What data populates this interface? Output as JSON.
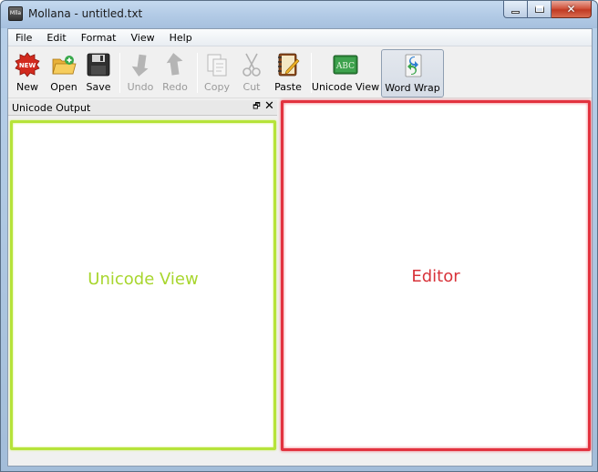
{
  "window": {
    "title": "Mollana - untitled.txt",
    "app_icon_text": "Mlla"
  },
  "menu": [
    {
      "label": "File"
    },
    {
      "label": "Edit"
    },
    {
      "label": "Format"
    },
    {
      "label": "View"
    },
    {
      "label": "Help"
    }
  ],
  "toolbar": {
    "new": {
      "label": "New",
      "icon": "new-document-icon",
      "enabled": true
    },
    "open": {
      "label": "Open",
      "icon": "open-folder-icon",
      "enabled": true
    },
    "save": {
      "label": "Save",
      "icon": "floppy-disk-icon",
      "enabled": true
    },
    "undo": {
      "label": "Undo",
      "icon": "undo-arrow-icon",
      "enabled": false
    },
    "redo": {
      "label": "Redo",
      "icon": "redo-arrow-icon",
      "enabled": false
    },
    "copy": {
      "label": "Copy",
      "icon": "copy-icon",
      "enabled": false
    },
    "cut": {
      "label": "Cut",
      "icon": "scissors-icon",
      "enabled": false
    },
    "paste": {
      "label": "Paste",
      "icon": "paste-notebook-icon",
      "enabled": true
    },
    "unicode_view": {
      "label": "Unicode View",
      "icon": "abc-board-icon",
      "enabled": true,
      "checked": false
    },
    "word_wrap": {
      "label": "Word Wrap",
      "icon": "wrap-arrows-icon",
      "enabled": true,
      "checked": true
    }
  },
  "dock": {
    "title": "Unicode Output",
    "float_glyph": "🗗",
    "close_glyph": "✕"
  },
  "panels": {
    "unicode_view_label": "Unicode View",
    "editor_label": "Editor"
  },
  "colors": {
    "unicode_view_border": "#b6e33a",
    "editor_border": "#e2333f"
  }
}
